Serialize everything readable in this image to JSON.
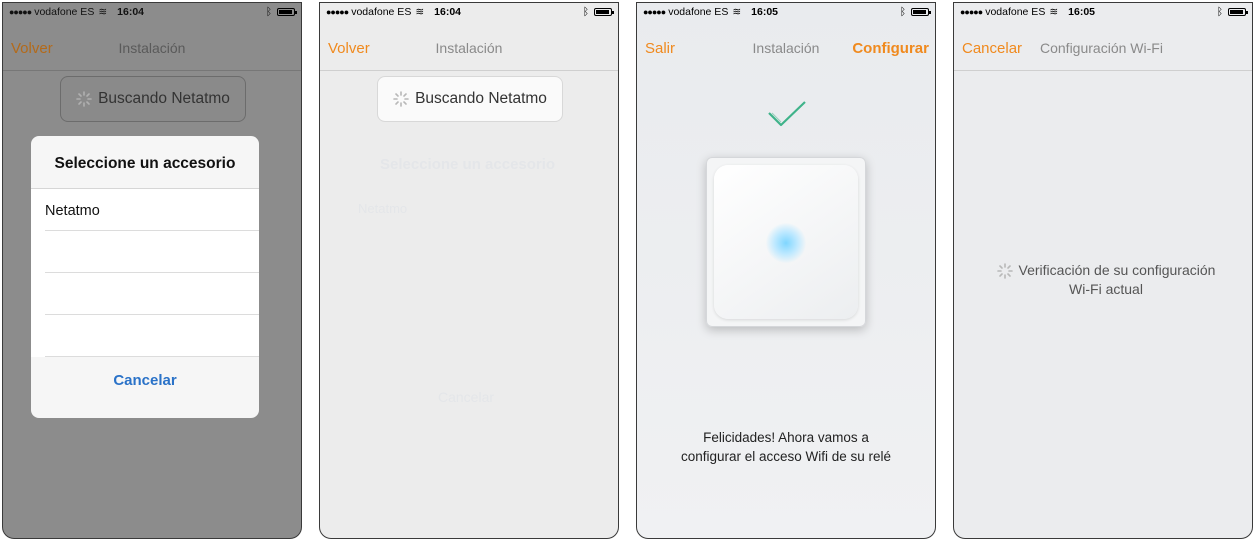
{
  "screens": [
    {
      "status": {
        "carrier": "vodafone ES",
        "time": "16:04"
      },
      "nav": {
        "left": "Volver",
        "title": "Instalación",
        "right": ""
      },
      "search_label": "Buscando Netatmo",
      "sheet": {
        "title": "Seleccione un accesorio",
        "items": [
          "Netatmo",
          "",
          "",
          ""
        ],
        "cancel": "Cancelar"
      }
    },
    {
      "status": {
        "carrier": "vodafone ES",
        "time": "16:04"
      },
      "nav": {
        "left": "Volver",
        "title": "Instalación",
        "right": ""
      },
      "search_label": "Buscando Netatmo",
      "ghost": {
        "title": "Seleccione un accesorio",
        "item": "Netatmo",
        "cancel": "Cancelar"
      }
    },
    {
      "status": {
        "carrier": "vodafone ES",
        "time": "16:05"
      },
      "nav": {
        "left": "Salir",
        "title": "Instalación",
        "right": "Configurar"
      },
      "message_line1": "Felicidades! Ahora vamos a",
      "message_line2": "configurar el acceso Wifi de su relé"
    },
    {
      "status": {
        "carrier": "vodafone ES",
        "time": "16:05"
      },
      "nav": {
        "left": "Cancelar",
        "title": "Configuración Wi-Fi",
        "right": ""
      },
      "message_line1": "Verificación de su configuración",
      "message_line2": "Wi-Fi actual"
    }
  ],
  "icons": {
    "signal": "signal-dots-icon",
    "wifi": "wifi-icon",
    "bluetooth": "bluetooth-icon",
    "battery": "battery-icon",
    "spinner": "spinner-icon",
    "check": "checkmark-icon"
  },
  "colors": {
    "accent": "#f08a1e",
    "cancel_blue": "#2a72c8",
    "overlay": "#8c8c8c",
    "glow": "#7fd6ff"
  }
}
